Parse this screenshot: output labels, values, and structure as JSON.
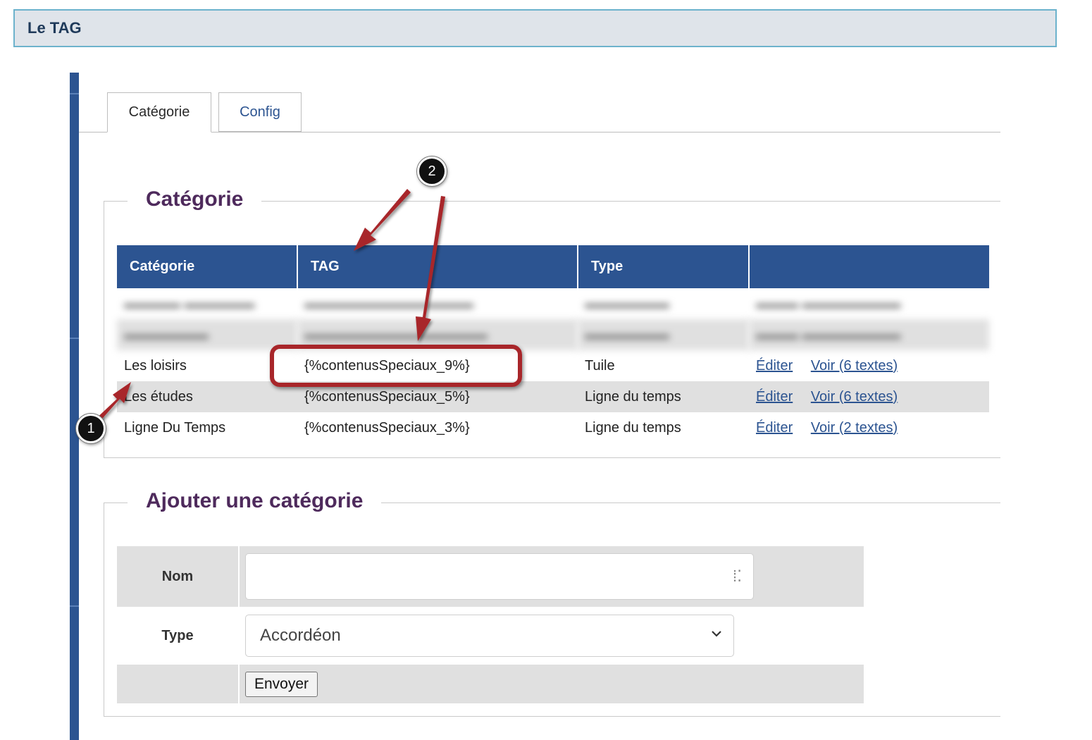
{
  "header": {
    "title": "Le TAG"
  },
  "tabs": [
    {
      "label": "Catégorie",
      "active": true
    },
    {
      "label": "Config",
      "active": false
    }
  ],
  "category_section": {
    "legend": "Catégorie",
    "columns": [
      "Catégorie",
      "TAG",
      "Type",
      ""
    ],
    "rows": [
      {
        "name": "Les loisirs",
        "tag": "{%contenusSpeciaux_9%}",
        "type": "Tuile",
        "edit": "Éditer",
        "view": "Voir (6 textes)"
      },
      {
        "name": "Les études",
        "tag": "{%contenusSpeciaux_5%}",
        "type": "Ligne du temps",
        "edit": "Éditer",
        "view": "Voir (6 textes)"
      },
      {
        "name": "Ligne Du Temps",
        "tag": "{%contenusSpeciaux_3%}",
        "type": "Ligne du temps",
        "edit": "Éditer",
        "view": "Voir (2 textes)"
      }
    ]
  },
  "add_section": {
    "legend": "Ajouter une catégorie",
    "name_label": "Nom",
    "name_value": "",
    "type_label": "Type",
    "type_selected": "Accordéon",
    "submit_label": "Envoyer"
  },
  "annotations": {
    "badge1": "1",
    "badge2": "2",
    "color": "#a8262a"
  }
}
